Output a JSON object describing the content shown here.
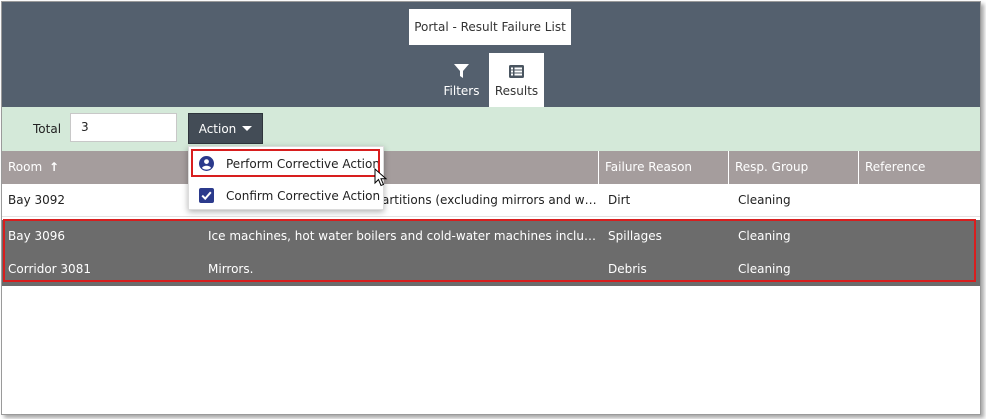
{
  "window": {
    "title": "Portal - Result Failure List"
  },
  "tabs": [
    {
      "label": "Filters",
      "icon": "filter-icon"
    },
    {
      "label": "Results",
      "icon": "list-icon"
    }
  ],
  "toolbar": {
    "total_label": "Total",
    "total_value": "3",
    "action_label": "Action"
  },
  "table": {
    "columns": [
      "Room",
      "Failure Reason",
      "Resp. Group",
      "Reference"
    ],
    "sort_indicator": "↑",
    "rows": [
      {
        "room": "Bay 3092",
        "description": "artitions (excluding mirrors and wi...",
        "reason": "Dirt",
        "group": "Cleaning",
        "reference": ""
      },
      {
        "room": "Bay 3096",
        "description": "Ice machines, hot water boilers and cold-water machines includi...",
        "reason": "Spillages",
        "group": "Cleaning",
        "reference": ""
      },
      {
        "room": "Corridor 3081",
        "description": "Mirrors.",
        "reason": "Debris",
        "group": "Cleaning",
        "reference": ""
      }
    ]
  },
  "action_menu": {
    "items": [
      {
        "label": "Perform Corrective Action",
        "icon": "user-circle-icon"
      },
      {
        "label": "Confirm Corrective Action",
        "icon": "checkbox-checked-icon"
      }
    ]
  },
  "colors": {
    "header": "#54606e",
    "toolbar": "#d4e9d9",
    "table_header": "#a59d9d",
    "selected_row": "#6c6c6c",
    "highlight": "#d81e1e",
    "icon_accent": "#2b3a8c"
  }
}
